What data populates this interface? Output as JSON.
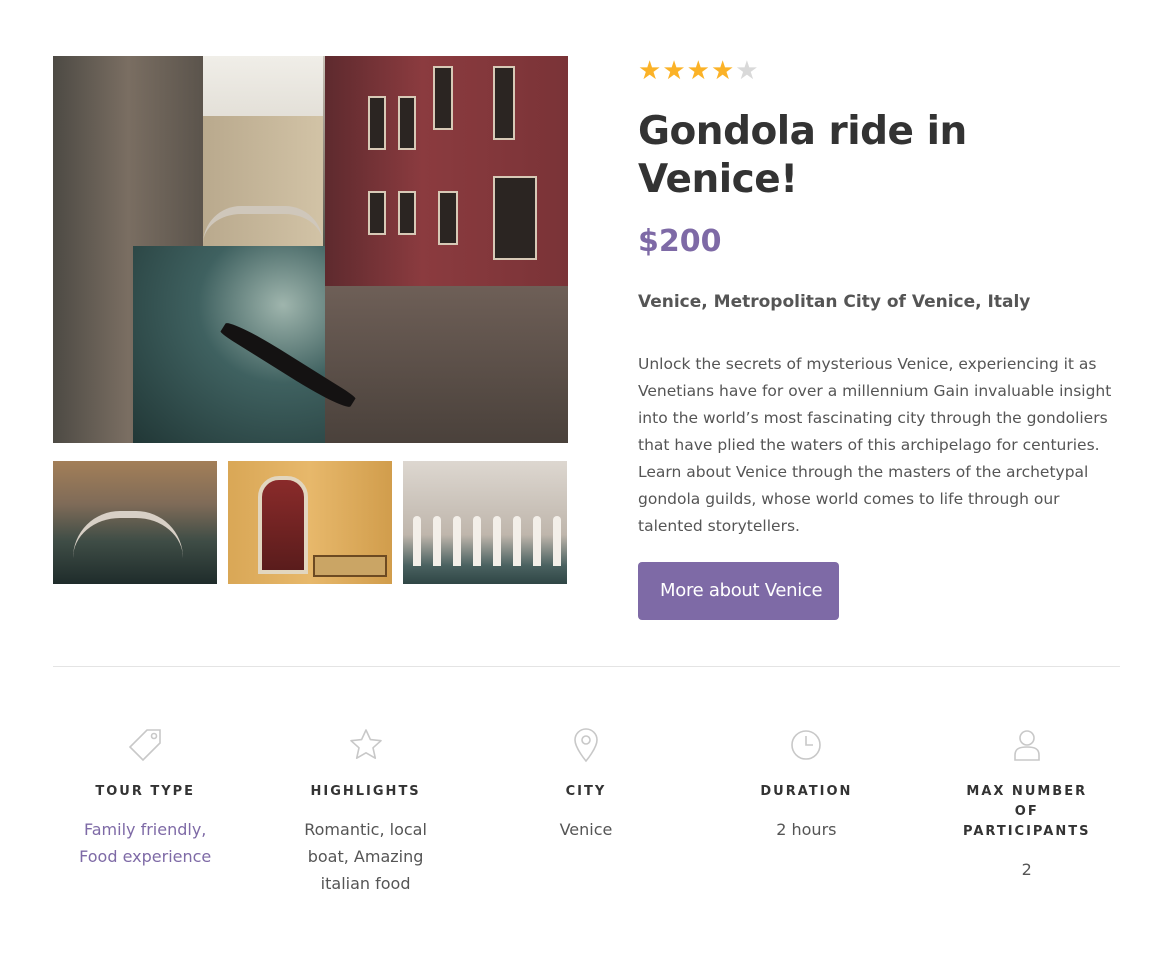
{
  "rating": {
    "filled": 4,
    "total": 5
  },
  "tour": {
    "title": "Gondola ride in Venice!",
    "price": "$200",
    "location": "Venice, Metropolitan City of Venice, Italy",
    "description": "Unlock the secrets of mysterious Venice, experiencing it as Venetians have for over a millennium Gain invaluable insight into the world’s most fascinating city through the gondoliers that have plied the waters of this archipelago for centuries. Learn about Venice through the masters of the archetypal gondola guilds, whose world comes to life through our talented storytellers.",
    "more_button": "More about Venice"
  },
  "features": [
    {
      "icon": "tag-icon",
      "label": "Tour type",
      "value": "Family friendly,\nFood experience"
    },
    {
      "icon": "star-icon",
      "label": "Highlights",
      "value": "Romantic, local boat, Amazing italian food"
    },
    {
      "icon": "map-pin-icon",
      "label": "City",
      "value": "Venice"
    },
    {
      "icon": "clock-icon",
      "label": "Duration",
      "value": "2 hours"
    },
    {
      "icon": "user-icon",
      "label": "Max number of participants",
      "value": "2"
    }
  ],
  "colors": {
    "accent": "#7e6aa6",
    "star": "#fbb227",
    "star_empty": "#d9d9d9"
  }
}
